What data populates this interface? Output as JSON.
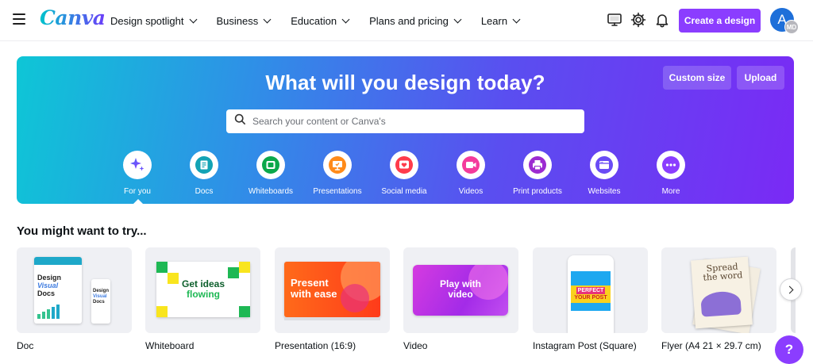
{
  "nav": {
    "logo": "Canva",
    "links": [
      {
        "label": "Design spotlight"
      },
      {
        "label": "Business"
      },
      {
        "label": "Education"
      },
      {
        "label": "Plans and pricing"
      },
      {
        "label": "Learn"
      }
    ],
    "icons": [
      "monitor-icon",
      "gear-icon",
      "bell-icon"
    ],
    "create_button": "Create a design",
    "avatar_initial": "A",
    "avatar_badge": "MD"
  },
  "hero": {
    "title": "What will you design today?",
    "custom_size": "Custom size",
    "upload": "Upload",
    "search_placeholder": "Search your content or Canva's",
    "categories": [
      {
        "label": "For you",
        "icon": "sparkle-icon",
        "color": "#7d2ae8"
      },
      {
        "label": "Docs",
        "icon": "doc-icon",
        "color": "#13a3b5"
      },
      {
        "label": "Whiteboards",
        "icon": "whiteboard-icon",
        "color": "#0ba84a"
      },
      {
        "label": "Presentations",
        "icon": "presentation-icon",
        "color": "#ff8b1a"
      },
      {
        "label": "Social media",
        "icon": "heart-icon",
        "color": "#ff3b4b"
      },
      {
        "label": "Videos",
        "icon": "video-icon",
        "color": "#f43b9c"
      },
      {
        "label": "Print products",
        "icon": "printer-icon",
        "color": "#9c2bd1"
      },
      {
        "label": "Websites",
        "icon": "website-icon",
        "color": "#6a4cf5"
      },
      {
        "label": "More",
        "icon": "more-icon",
        "color": "#8b3dff"
      }
    ]
  },
  "suggestions": {
    "title": "You might want to try...",
    "cards": [
      {
        "label": "Doc",
        "thumb_text": [
          "Design",
          "Visual",
          "Docs"
        ]
      },
      {
        "label": "Whiteboard",
        "thumb_text": [
          "Get ideas",
          "flowing"
        ]
      },
      {
        "label": "Presentation (16:9)",
        "thumb_text": [
          "Present",
          "with ease"
        ]
      },
      {
        "label": "Video",
        "thumb_text": [
          "Play with",
          "video"
        ]
      },
      {
        "label": "Instagram Post (Square)",
        "thumb_text": [
          "PERFECT",
          "YOUR POST"
        ]
      },
      {
        "label": "Flyer (A4 21 × 29.7 cm)",
        "thumb_text": [
          "Spread",
          "the word"
        ]
      }
    ]
  },
  "help_button": "?"
}
